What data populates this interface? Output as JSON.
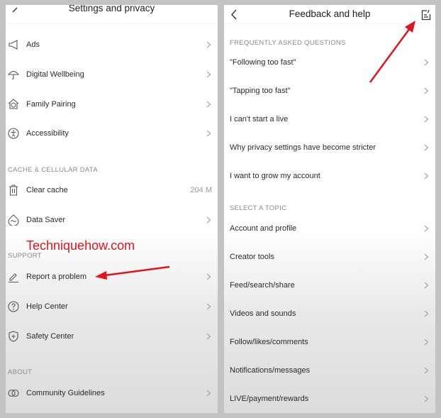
{
  "left_panel": {
    "title": "Settings and privacy",
    "items": [
      {
        "label": "Ads",
        "icon": "megaphone-icon"
      },
      {
        "label": "Digital Wellbeing",
        "icon": "umbrella-icon"
      },
      {
        "label": "Family Pairing",
        "icon": "house-heart-icon"
      },
      {
        "label": "Accessibility",
        "icon": "accessibility-icon"
      }
    ],
    "cache_section": "CACHE & CELLULAR DATA",
    "cache_items": [
      {
        "label": "Clear cache",
        "icon": "trash-icon",
        "value": "204 M"
      },
      {
        "label": "Data Saver",
        "icon": "data-saver-icon"
      }
    ],
    "support_section": "SUPPORT",
    "support_items": [
      {
        "label": "Report a problem",
        "icon": "pencil-icon"
      },
      {
        "label": "Help Center",
        "icon": "question-circle-icon"
      },
      {
        "label": "Safety Center",
        "icon": "shield-plus-icon"
      }
    ],
    "about_section": "ABOUT",
    "about_items": [
      {
        "label": "Community Guidelines",
        "icon": "rings-icon"
      }
    ]
  },
  "right_panel": {
    "title": "Feedback and help",
    "faq_section": "FREQUENTLY ASKED QUESTIONS",
    "faq_items": [
      "\"Following too fast\"",
      "\"Tapping too fast\"",
      "I can't start a live",
      "Why privacy settings have become stricter",
      "I want to grow my account"
    ],
    "topic_section": "SELECT A TOPIC",
    "topic_items": [
      "Account and profile",
      "Creator tools",
      "Feed/search/share",
      "Videos and sounds",
      "Follow/likes/comments",
      "Notifications/messages",
      "LIVE/payment/rewards"
    ]
  },
  "watermark": "Techniquehow.com",
  "colors": {
    "annotation_red": "#e2131b",
    "background": "#c3c3c3"
  }
}
